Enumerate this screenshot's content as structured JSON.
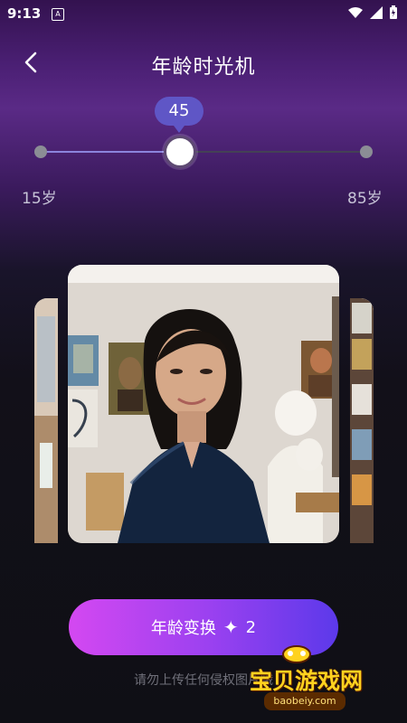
{
  "status": {
    "time": "9:13",
    "notification_label": "A"
  },
  "header": {
    "title": "年龄时光机"
  },
  "slider": {
    "current_age": "45",
    "min_label": "15岁",
    "max_label": "85岁",
    "current_fraction": 0.428
  },
  "button": {
    "label": "年龄变换",
    "credits": "2",
    "spark": "✦"
  },
  "disclaimer": "请勿上传任何侵权图片哦",
  "watermark": {
    "brand": "宝贝游戏网",
    "domain": "baobeiy.com"
  },
  "icons": {
    "back": "back-arrow-icon",
    "wifi": "wifi-icon",
    "signal": "signal-icon",
    "battery": "battery-icon",
    "spark": "sparkle-icon"
  }
}
